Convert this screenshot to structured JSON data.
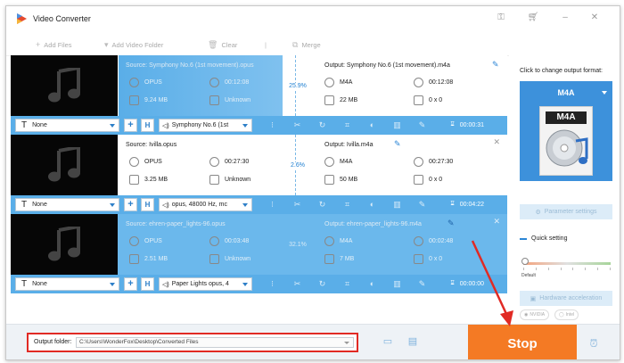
{
  "app": {
    "title": "Video Converter"
  },
  "toolbar": {
    "add_files": "Add Files",
    "add_video_folder": "Add Video Folder",
    "clear": "Clear",
    "merge": "Merge"
  },
  "files": [
    {
      "source_name": "Source: Symphony No.6 (1st movement).opus",
      "src_format": "OPUS",
      "src_duration": "00:12:08",
      "src_size": "9.24 MB",
      "src_resolution": "Unknown",
      "progress": "25.9%",
      "progress_value": 25.9,
      "output_name": "Output: Symphony No.6 (1st movement).m4a",
      "out_format": "M4A",
      "out_duration": "00:12:08",
      "out_size": "22 MB",
      "out_resolution": "0 x 0",
      "subtitle": "None",
      "audio_track": "Symphony No.6 (1st",
      "remaining": "00:00:31"
    },
    {
      "source_name": "Source: Ivilla.opus",
      "src_format": "OPUS",
      "src_duration": "00:27:30",
      "src_size": "3.25 MB",
      "src_resolution": "Unknown",
      "progress": "2.6%",
      "progress_value": 2.6,
      "output_name": "Output: Ivilla.m4a",
      "out_format": "M4A",
      "out_duration": "00:27:30",
      "out_size": "50 MB",
      "out_resolution": "0 x 0",
      "subtitle": "None",
      "audio_track": "opus, 48000 Hz, mc",
      "remaining": "00:04:22"
    },
    {
      "source_name": "Source: ehren-paper_lights-96.opus",
      "src_format": "OPUS",
      "src_duration": "00:03:48",
      "src_size": "2.51 MB",
      "src_resolution": "Unknown",
      "progress": "32.1%",
      "progress_value": 32.1,
      "output_name": "Output: ehren-paper_lights-96.m4a",
      "out_format": "M4A",
      "out_duration": "00:02:48",
      "out_size": "7 MB",
      "out_resolution": "0 x 0",
      "subtitle": "None",
      "audio_track": "Paper Lights opus, 4",
      "remaining": "00:00:00"
    }
  ],
  "right_panel": {
    "click_to_change": "Click to change output format:",
    "format": "M4A",
    "parameter_settings": "Parameter settings",
    "quick_setting": "Quick setting",
    "default": "Default",
    "hw_accel": "Hardware acceleration",
    "nvidia": "NVIDIA",
    "intel": "Intel"
  },
  "bottom": {
    "output_folder_label": "Output folder:",
    "output_folder_path": "C:\\Users\\WonderFox\\Desktop\\Converted Files",
    "stop": "Stop"
  },
  "colors": {
    "accent": "#5aaee8",
    "selected_row": "#6bb8ec",
    "stop": "#f47a24",
    "highlight": "#e12a24"
  }
}
